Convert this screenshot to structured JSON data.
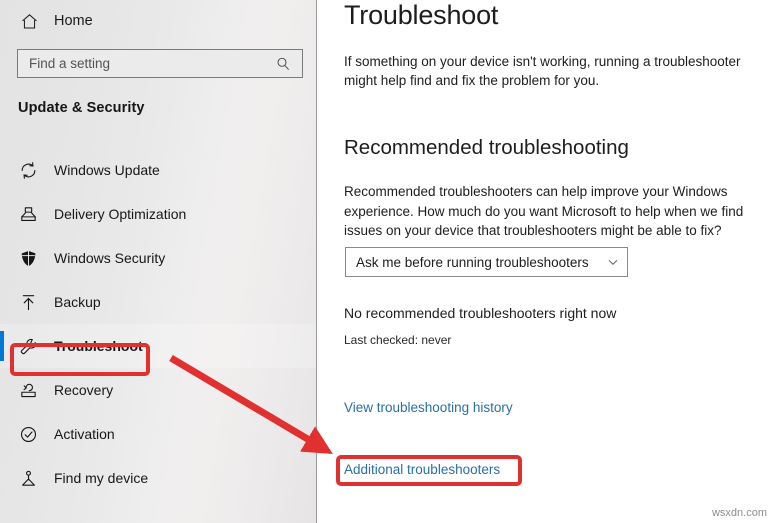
{
  "sidebar": {
    "home": {
      "label": "Home",
      "icon": "home-icon"
    },
    "search": {
      "value": "",
      "placeholder": "Find a setting",
      "icon": "search-icon"
    },
    "category_title": "Update & Security",
    "items": [
      {
        "label": "Windows Update",
        "icon": "sync-icon",
        "selected": false
      },
      {
        "label": "Delivery Optimization",
        "icon": "delivery-icon",
        "selected": false
      },
      {
        "label": "Windows Security",
        "icon": "shield-icon",
        "selected": false
      },
      {
        "label": "Backup",
        "icon": "upload-icon",
        "selected": false
      },
      {
        "label": "Troubleshoot",
        "icon": "wrench-icon",
        "selected": true
      },
      {
        "label": "Recovery",
        "icon": "recovery-icon",
        "selected": false
      },
      {
        "label": "Activation",
        "icon": "checkmark-circle-icon",
        "selected": false
      },
      {
        "label": "Find my device",
        "icon": "person-pin-icon",
        "selected": false
      }
    ]
  },
  "content": {
    "title": "Troubleshoot",
    "description": "If something on your device isn't working, running a troubleshooter might help find and fix the problem for you.",
    "section": {
      "heading": "Recommended troubleshooting",
      "description": "Recommended troubleshooters can help improve your Windows experience. How much do you want Microsoft to help when we find issues on your device that troubleshooters might be able to fix?",
      "dropdown": {
        "selected": "Ask me before running troubleshooters",
        "icon": "chevron-down-icon"
      },
      "status": "No recommended troubleshooters right now",
      "last_checked": "Last checked: never"
    },
    "links": [
      {
        "label": "View troubleshooting history"
      },
      {
        "label": "Additional troubleshooters"
      }
    ]
  },
  "watermark": "wsxdn.com",
  "colors": {
    "accent_blue": "#0078d7",
    "link_blue": "#2a6fa8",
    "annotation_red": "#e03030",
    "sidebar_divider": "#9a9a9a"
  }
}
